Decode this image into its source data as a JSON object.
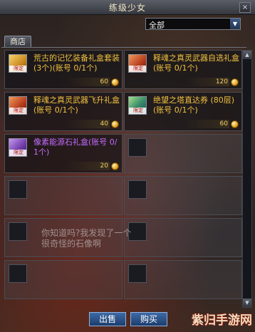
{
  "window": {
    "title": "练级少女",
    "close_label": "×"
  },
  "filter": {
    "selected": "全部",
    "arrow": "▼"
  },
  "tab": {
    "label": "商店"
  },
  "items": [
    {
      "name": "荒古的记忆装备礼盒套装(3个)(账号 0/1个)",
      "price": "60",
      "limited": "限定",
      "color": "gold",
      "icon": "gift-gold-icon"
    },
    {
      "name": "释魂之真灵武器自选礼盒(账号 0/1个)",
      "price": "120",
      "limited": "限定",
      "color": "gold",
      "icon": "gift-red-icon"
    },
    {
      "name": "释魂之真灵武器飞升礼盒(账号 0/1个)",
      "price": "40",
      "limited": "限定",
      "color": "gold",
      "icon": "gift-red-icon"
    },
    {
      "name": "绝望之塔直达券 (80层)(账号 0/1个)",
      "price": "60",
      "limited": "限定",
      "color": "gold",
      "icon": "ticket-icon"
    },
    {
      "name": "像素能源石礼盒(账号 0/1个)",
      "price": "20",
      "limited": "限定",
      "color": "purple",
      "icon": "gift-purple-icon"
    }
  ],
  "chat_overlay": "你知道吗?我发现了一个很奇怪的石像啊",
  "buttons": {
    "sell": "出售",
    "buy": "购买"
  },
  "watermark": "紫归手游网",
  "scrollbar": {
    "up": "▲",
    "down": "▼"
  }
}
